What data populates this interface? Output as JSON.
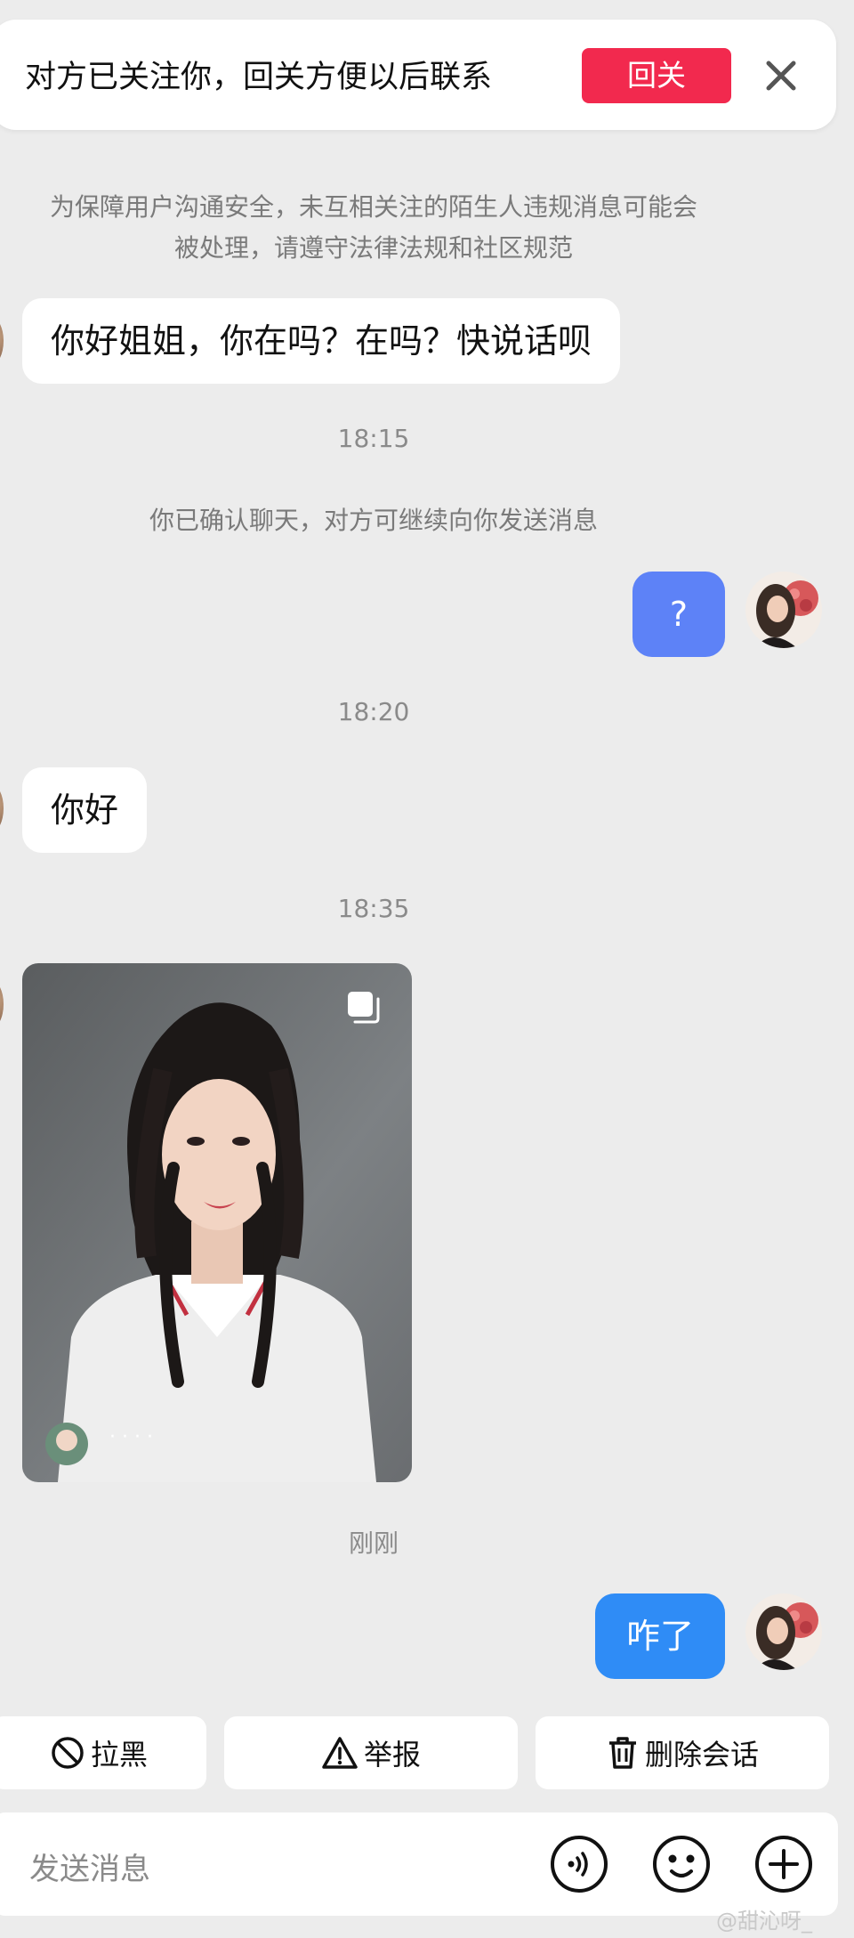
{
  "banner": {
    "text": "对方已关注你，回关方便以后联系",
    "follow_label": "回关",
    "close_icon": "close-icon"
  },
  "notice": {
    "line1": "为保障用户沟通安全，未互相关注的陌生人违规消息可能会",
    "line2": "被处理，请遵守法律法规和社区规范"
  },
  "messages": {
    "m1": "你好姐姐，你在吗？在吗？快说话呗",
    "t1": "18:15",
    "sys1": "你已确认聊天，对方可继续向你发送消息",
    "m2": "?",
    "t2": "18:20",
    "m3": "你好",
    "t3": "18:35",
    "photo_caption": "· · · ·",
    "t4": "刚刚",
    "m4": "咋了"
  },
  "actions": {
    "block": "拉黑",
    "report": "举报",
    "delete": "删除会话"
  },
  "input": {
    "placeholder": "发送消息"
  },
  "icons": [
    "close-icon",
    "block-icon",
    "warning-icon",
    "trash-icon",
    "voice-icon",
    "emoji-icon",
    "plus-icon",
    "multi-photo-icon"
  ],
  "colors": {
    "follow_button": "#f2294e",
    "my_bubble_1": "#5d82f7",
    "my_bubble_2": "#2f8cf6",
    "background": "#ececec"
  },
  "watermark": "@甜沁呀_"
}
